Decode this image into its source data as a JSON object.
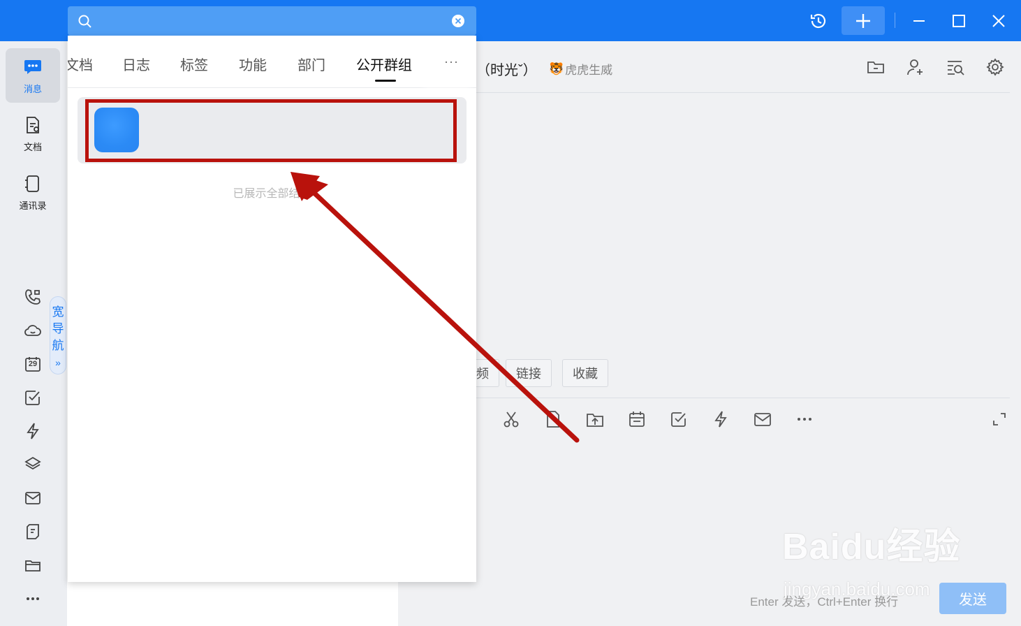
{
  "search": {
    "value": "",
    "placeholder": ""
  },
  "sidebar": {
    "items": [
      {
        "label": "消息",
        "icon": "message-icon",
        "active": true
      },
      {
        "label": "文档",
        "icon": "document-icon",
        "active": false
      },
      {
        "label": "通讯录",
        "icon": "contacts-icon",
        "active": false
      }
    ],
    "tools": [
      "phone-icon",
      "cloud-icon",
      "calendar-icon",
      "todo-icon",
      "lightning-icon",
      "layers-icon",
      "mail-icon",
      "notes-icon",
      "folder-icon",
      "more-icon"
    ],
    "calendar_day": "29",
    "wide_nav": [
      "宽",
      "导",
      "航"
    ]
  },
  "search_tabs": {
    "tabs": [
      "文档",
      "日志",
      "标签",
      "功能",
      "部门",
      "公开群组"
    ],
    "active": "公开群组",
    "more": "···"
  },
  "results": {
    "end_note": "已展示全部结果"
  },
  "chat": {
    "title": "（时光ˇ）",
    "subtitle": "虎虎生威",
    "chips": [
      "频",
      "链接",
      "收藏"
    ],
    "hint": "Enter 发送，Ctrl+Enter 换行",
    "send_label": "发送"
  },
  "watermark": {
    "main": "Baidu经验",
    "url": "jingyan.baidu.com"
  },
  "colors": {
    "accent": "#1677f2",
    "highlight": "#b9120c"
  }
}
